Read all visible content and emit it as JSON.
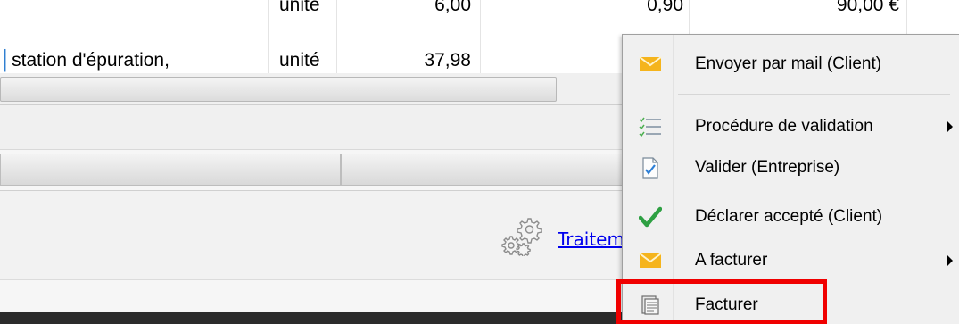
{
  "table": {
    "rows": [
      {
        "description": "",
        "unit": "unité",
        "quantity": "6,00",
        "price": "0,90",
        "total": "90,00 €"
      },
      {
        "description": "station d'épuration,",
        "unit": "unité",
        "quantity": "37,98",
        "price": "",
        "total": ""
      }
    ]
  },
  "link": {
    "traiter": "Traitement"
  },
  "context_menu": {
    "items": [
      {
        "label": "Envoyer par mail (Client)",
        "icon": "envelope-icon",
        "submenu": false
      },
      {
        "label": "Procédure de validation",
        "icon": "checklist-icon",
        "submenu": true
      },
      {
        "label": "Valider (Entreprise)",
        "icon": "document-check-icon",
        "submenu": false
      },
      {
        "label": "Déclarer accepté (Client)",
        "icon": "checkmark-icon",
        "submenu": false
      },
      {
        "label": "A facturer",
        "icon": "envelope-icon",
        "submenu": true
      },
      {
        "label": "Facturer",
        "icon": "invoice-icon",
        "submenu": false
      }
    ]
  },
  "colors": {
    "highlight": "#f00000",
    "envelope": "#f5b41c",
    "checkmark": "#2ea043",
    "link": "#0000ee"
  }
}
